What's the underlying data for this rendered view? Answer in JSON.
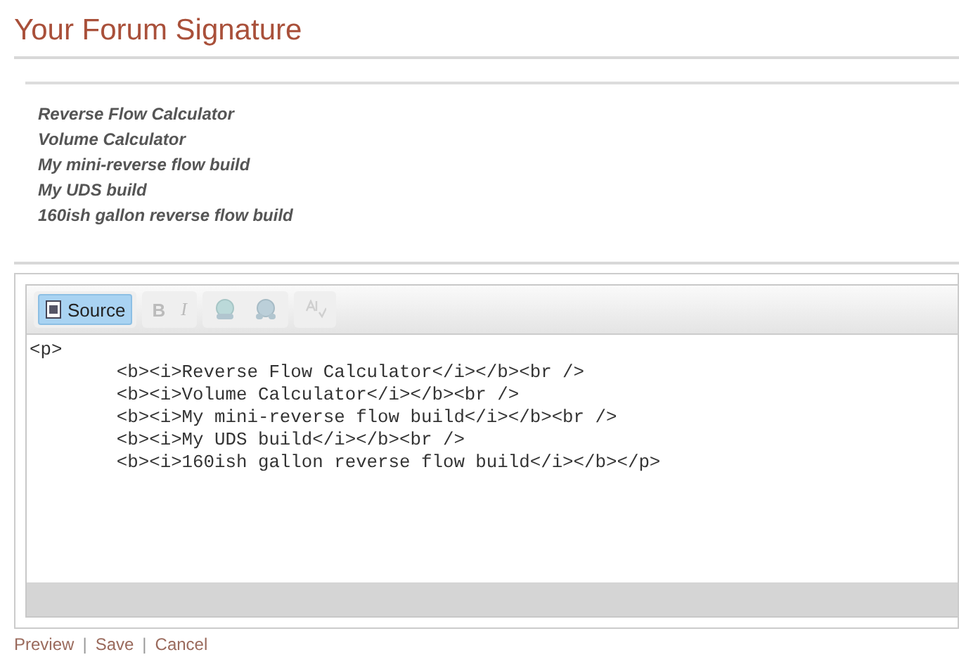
{
  "title": "Your Forum Signature",
  "preview_lines": [
    "Reverse Flow Calculator",
    "Volume Calculator",
    "My mini-reverse flow build",
    "My UDS build",
    "160ish gallon reverse flow build"
  ],
  "toolbar": [
    {
      "kind": "source",
      "label": "Source",
      "selected": true,
      "disabled": false
    },
    {
      "kind": "bold",
      "label": "B",
      "selected": false,
      "disabled": true
    },
    {
      "kind": "italic",
      "label": "I",
      "selected": false,
      "disabled": true
    },
    {
      "kind": "link",
      "disabled": true
    },
    {
      "kind": "unlink",
      "disabled": true
    },
    {
      "kind": "spellcheck",
      "disabled": true
    }
  ],
  "source": "<p>\n\t<b><i>Reverse Flow Calculator</i></b><br />\n\t<b><i>Volume Calculator</i></b><br />\n\t<b><i>My mini-reverse flow build</i></b><br />\n\t<b><i>My UDS build</i></b><br />\n\t<b><i>160ish gallon reverse flow build</i></b></p>",
  "links": [
    {
      "label": "Preview"
    },
    {
      "label": "Save"
    },
    {
      "label": "Cancel"
    }
  ],
  "separator": "|"
}
